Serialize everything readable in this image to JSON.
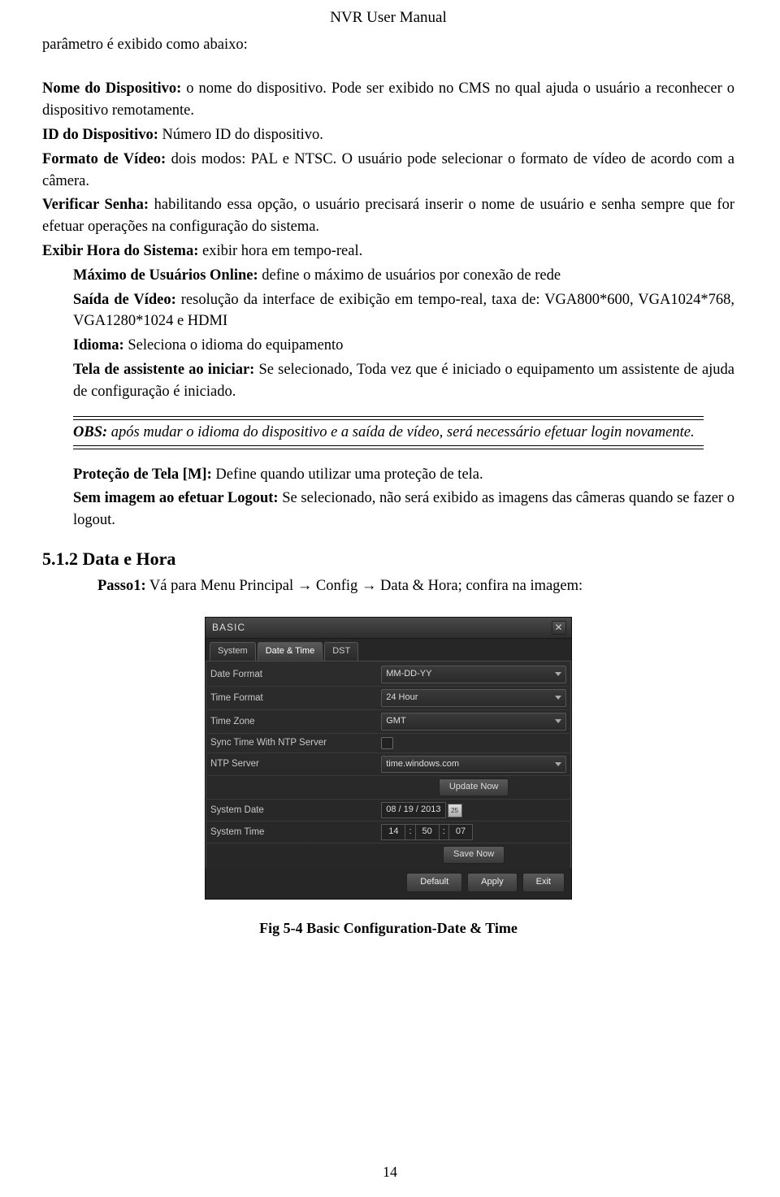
{
  "header": "NVR User Manual",
  "intro": "parâmetro é exibido como abaixo:",
  "p_nome_b": "Nome do Dispositivo:",
  "p_nome_t": " o nome do dispositivo. Pode ser exibido no CMS no qual ajuda o usuário a reconhecer o dispositivo remotamente.",
  "p_id_b": "ID do Dispositivo:",
  "p_id_t": " Número ID do dispositivo.",
  "p_fmt_b": "Formato de Vídeo:",
  "p_fmt_t": " dois modos: PAL e NTSC. O usuário pode selecionar o formato de vídeo de acordo com a câmera.",
  "p_ver_b": "Verificar Senha:",
  "p_ver_t": " habilitando essa opção, o usuário precisará inserir o nome de usuário e senha sempre que for efetuar operações na configuração do sistema.",
  "p_hora_b": "Exibir Hora do Sistema:",
  "p_hora_t": " exibir hora em tempo-real.",
  "p_max_b": "Máximo de Usuários Online:",
  "p_max_t": " define o máximo de usuários por conexão de rede",
  "p_saida_b": "Saída de Vídeo:",
  "p_saida_t": " resolução da interface de exibição em tempo-real, taxa de: VGA800*600, VGA1024*768, VGA1280*1024 e HDMI",
  "p_idioma_b": "Idioma:",
  "p_idioma_t": " Seleciona o idioma do equipamento",
  "p_tela_b": "Tela de assistente ao iniciar:",
  "p_tela_t": " Se selecionado, Toda vez que é iniciado o equipamento um assistente de ajuda de configuração é iniciado.",
  "obs_b": "OBS:",
  "obs_t": " após mudar o idioma do dispositivo e a saída de vídeo, será necessário efetuar login novamente.",
  "p_prot_b": "Proteção de Tela [M]:",
  "p_prot_t": " Define quando utilizar uma proteção de tela.",
  "p_sem_b": "Sem imagem ao efetuar Logout:",
  "p_sem_t": " Se selecionado, não será exibido as imagens das câmeras quando se fazer o logout.",
  "h2": "5.1.2 Data e Hora",
  "passo_b": "Passo1:",
  "passo_t": " Vá para Menu Principal → Config → Data & Hora; confira na imagem:",
  "dialog": {
    "title": "BASIC",
    "tabs": {
      "system": "System",
      "datetime": "Date & Time",
      "dst": "DST"
    },
    "labels": {
      "date_format": "Date Format",
      "time_format": "Time Format",
      "time_zone": "Time Zone",
      "sync_ntp": "Sync Time With NTP Server",
      "ntp_server": "NTP Server",
      "system_date": "System Date",
      "system_time": "System Time"
    },
    "values": {
      "date_format": "MM-DD-YY",
      "time_format": "24 Hour",
      "time_zone": "GMT",
      "ntp_server": "time.windows.com",
      "system_date": "08 / 19 / 2013",
      "time_h": "14",
      "time_m": "50",
      "time_s": "07"
    },
    "buttons": {
      "update_now": "Update Now",
      "save_now": "Save Now",
      "default": "Default",
      "apply": "Apply",
      "exit": "Exit"
    },
    "cal_icon": "25"
  },
  "fig_caption": "Fig 5-4 Basic Configuration-Date & Time",
  "page_num": "14"
}
